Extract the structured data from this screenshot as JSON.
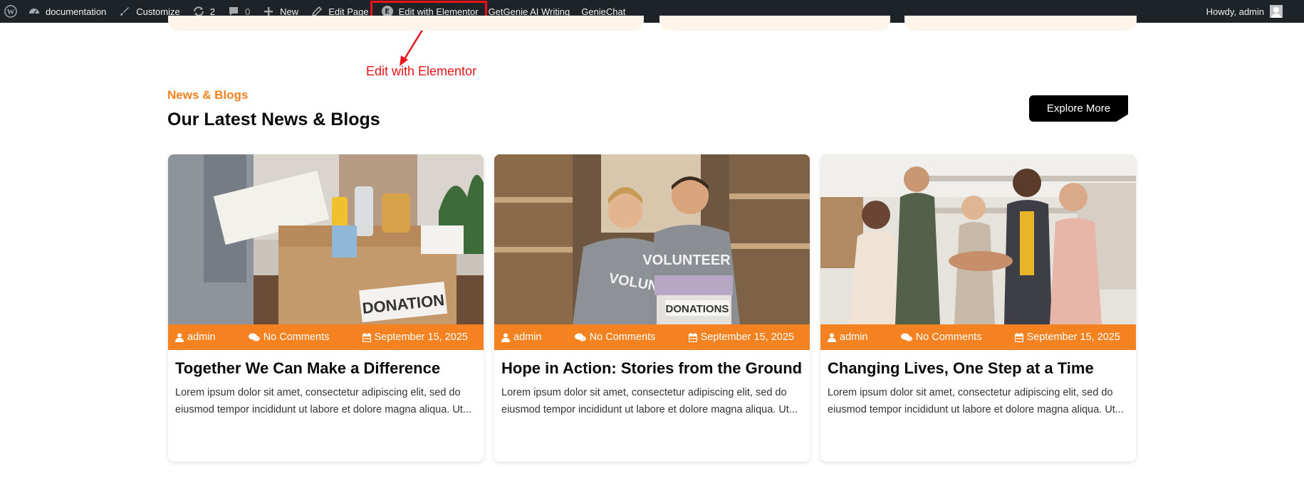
{
  "admin_bar": {
    "site_name": "documentation",
    "customize": "Customize",
    "updates_count": "2",
    "comments_count": "0",
    "new": "New",
    "edit_page": "Edit Page",
    "edit_with_elementor": "Edit with Elementor",
    "getgenie": "GetGenie AI Writing",
    "geniechat": "GenieChat",
    "howdy": "Howdy, admin"
  },
  "annotation": {
    "label": "Edit with Elementor",
    "color": "#e8141a"
  },
  "section": {
    "eyebrow": "News & Blogs",
    "title": "Our Latest News & Blogs",
    "explore_button": "Explore More"
  },
  "colors": {
    "accent": "#f58220",
    "admin_bar_bg": "#1d2327"
  },
  "posts": [
    {
      "author": "admin",
      "comments": "No Comments",
      "date": "September 15, 2025",
      "title": "Together We Can Make a Difference",
      "excerpt": "Lorem ipsum dolor sit amet, consectetur adipiscing elit, sed do eiusmod tempor incididunt ut labore et dolore magna aliqua. Ut..."
    },
    {
      "author": "admin",
      "comments": "No Comments",
      "date": "September 15, 2025",
      "title": "Hope in Action: Stories from the Ground",
      "excerpt": "Lorem ipsum dolor sit amet, consectetur adipiscing elit, sed do eiusmod tempor incididunt ut labore et dolore magna aliqua. Ut..."
    },
    {
      "author": "admin",
      "comments": "No Comments",
      "date": "September 15, 2025",
      "title": "Changing Lives, One Step at a Time",
      "excerpt": "Lorem ipsum dolor sit amet, consectetur adipiscing elit, sed do eiusmod tempor incididunt ut labore et dolore magna aliqua. Ut..."
    }
  ],
  "image_text": {
    "post1_box": "DONATION",
    "post2_box": "DONATIONS",
    "post2_shirt": "VOLUNTEER"
  }
}
